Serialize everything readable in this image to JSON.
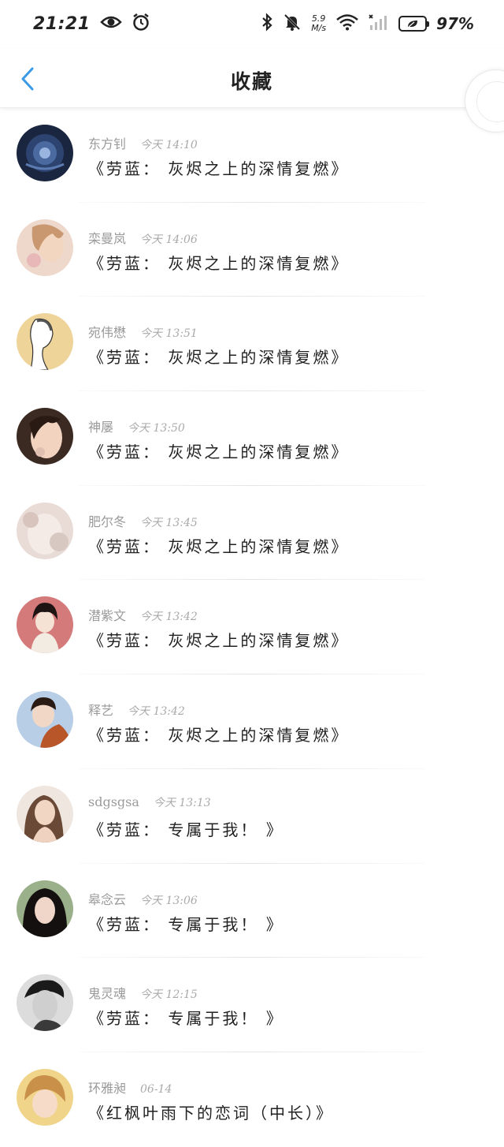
{
  "status_bar": {
    "time": "21:21",
    "net_speed_value": "5.9",
    "net_speed_unit": "M/s",
    "battery": "97%"
  },
  "header": {
    "title": "收藏"
  },
  "favorites": [
    {
      "author": "东方钊",
      "time": "今天 14:10",
      "title": "《劳蓝： 灰烬之上的深情复燃》",
      "avatar_color": "#1c2a48"
    },
    {
      "author": "栾曼岚",
      "time": "今天 14:06",
      "title": "《劳蓝： 灰烬之上的深情复燃》",
      "avatar_color": "#d8a8a0"
    },
    {
      "author": "宛伟懋",
      "time": "今天 13:51",
      "title": "《劳蓝： 灰烬之上的深情复燃》",
      "avatar_color": "#e8c98a"
    },
    {
      "author": "神屡",
      "time": "今天 13:50",
      "title": "《劳蓝： 灰烬之上的深情复燃》",
      "avatar_color": "#c9a48c"
    },
    {
      "author": "肥尔冬",
      "time": "今天 13:45",
      "title": "《劳蓝： 灰烬之上的深情复燃》",
      "avatar_color": "#d9c8c0"
    },
    {
      "author": "潜紫文",
      "time": "今天 13:42",
      "title": "《劳蓝： 灰烬之上的深情复燃》",
      "avatar_color": "#d07878"
    },
    {
      "author": "释艺",
      "time": "今天 13:42",
      "title": "《劳蓝： 灰烬之上的深情复燃》",
      "avatar_color": "#9ab8d8"
    },
    {
      "author": "sdgsgsa",
      "time": "今天 13:13",
      "title": "《劳蓝： 专属于我！ 》",
      "avatar_color": "#b89078"
    },
    {
      "author": "皋念云",
      "time": "今天 13:06",
      "title": "《劳蓝： 专属于我！ 》",
      "avatar_color": "#3a3030"
    },
    {
      "author": "鬼灵魂",
      "time": "今天 12:15",
      "title": "《劳蓝： 专属于我！ 》",
      "avatar_color": "#6a6a6a"
    },
    {
      "author": "环雅昶",
      "time": "06-14",
      "title": "《红枫叶雨下的恋词（中长）》",
      "avatar_color": "#e6c078"
    }
  ]
}
